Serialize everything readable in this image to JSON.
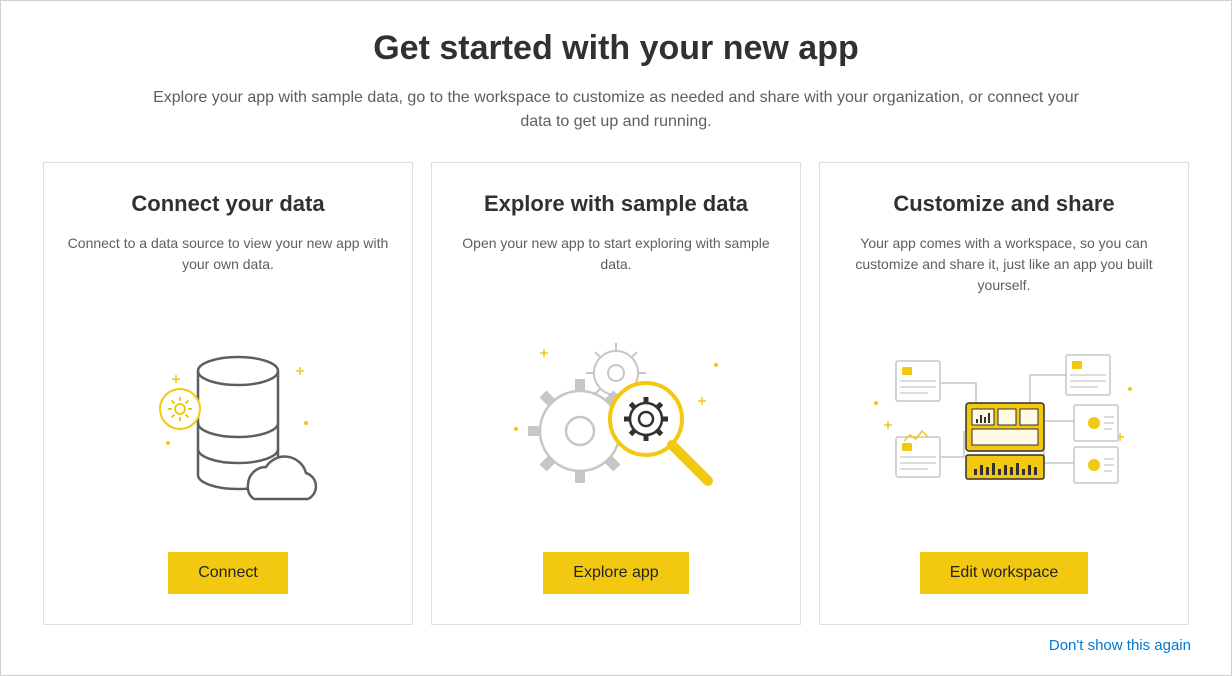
{
  "header": {
    "title": "Get started with your new app",
    "subtitle": "Explore your app with sample data, go to the workspace to customize as needed and share with your organization, or connect your data to get up and running."
  },
  "cards": [
    {
      "title": "Connect your data",
      "description": "Connect to a data source to view your new app with your own data.",
      "button_label": "Connect"
    },
    {
      "title": "Explore with sample data",
      "description": "Open your new app to start exploring with sample data.",
      "button_label": "Explore app"
    },
    {
      "title": "Customize and share",
      "description": "Your app comes with a workspace, so you can customize and share it, just like an app you built yourself.",
      "button_label": "Edit workspace"
    }
  ],
  "footer": {
    "dont_show_label": "Don't show this again"
  }
}
